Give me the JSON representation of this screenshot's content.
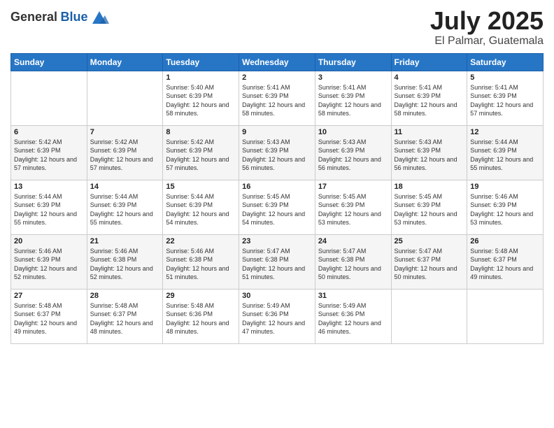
{
  "logo": {
    "general": "General",
    "blue": "Blue"
  },
  "title": "July 2025",
  "location": "El Palmar, Guatemala",
  "days_of_week": [
    "Sunday",
    "Monday",
    "Tuesday",
    "Wednesday",
    "Thursday",
    "Friday",
    "Saturday"
  ],
  "weeks": [
    [
      {
        "day": "",
        "sunrise": "",
        "sunset": "",
        "daylight": ""
      },
      {
        "day": "",
        "sunrise": "",
        "sunset": "",
        "daylight": ""
      },
      {
        "day": "1",
        "sunrise": "Sunrise: 5:40 AM",
        "sunset": "Sunset: 6:39 PM",
        "daylight": "Daylight: 12 hours and 58 minutes."
      },
      {
        "day": "2",
        "sunrise": "Sunrise: 5:41 AM",
        "sunset": "Sunset: 6:39 PM",
        "daylight": "Daylight: 12 hours and 58 minutes."
      },
      {
        "day": "3",
        "sunrise": "Sunrise: 5:41 AM",
        "sunset": "Sunset: 6:39 PM",
        "daylight": "Daylight: 12 hours and 58 minutes."
      },
      {
        "day": "4",
        "sunrise": "Sunrise: 5:41 AM",
        "sunset": "Sunset: 6:39 PM",
        "daylight": "Daylight: 12 hours and 58 minutes."
      },
      {
        "day": "5",
        "sunrise": "Sunrise: 5:41 AM",
        "sunset": "Sunset: 6:39 PM",
        "daylight": "Daylight: 12 hours and 57 minutes."
      }
    ],
    [
      {
        "day": "6",
        "sunrise": "Sunrise: 5:42 AM",
        "sunset": "Sunset: 6:39 PM",
        "daylight": "Daylight: 12 hours and 57 minutes."
      },
      {
        "day": "7",
        "sunrise": "Sunrise: 5:42 AM",
        "sunset": "Sunset: 6:39 PM",
        "daylight": "Daylight: 12 hours and 57 minutes."
      },
      {
        "day": "8",
        "sunrise": "Sunrise: 5:42 AM",
        "sunset": "Sunset: 6:39 PM",
        "daylight": "Daylight: 12 hours and 57 minutes."
      },
      {
        "day": "9",
        "sunrise": "Sunrise: 5:43 AM",
        "sunset": "Sunset: 6:39 PM",
        "daylight": "Daylight: 12 hours and 56 minutes."
      },
      {
        "day": "10",
        "sunrise": "Sunrise: 5:43 AM",
        "sunset": "Sunset: 6:39 PM",
        "daylight": "Daylight: 12 hours and 56 minutes."
      },
      {
        "day": "11",
        "sunrise": "Sunrise: 5:43 AM",
        "sunset": "Sunset: 6:39 PM",
        "daylight": "Daylight: 12 hours and 56 minutes."
      },
      {
        "day": "12",
        "sunrise": "Sunrise: 5:44 AM",
        "sunset": "Sunset: 6:39 PM",
        "daylight": "Daylight: 12 hours and 55 minutes."
      }
    ],
    [
      {
        "day": "13",
        "sunrise": "Sunrise: 5:44 AM",
        "sunset": "Sunset: 6:39 PM",
        "daylight": "Daylight: 12 hours and 55 minutes."
      },
      {
        "day": "14",
        "sunrise": "Sunrise: 5:44 AM",
        "sunset": "Sunset: 6:39 PM",
        "daylight": "Daylight: 12 hours and 55 minutes."
      },
      {
        "day": "15",
        "sunrise": "Sunrise: 5:44 AM",
        "sunset": "Sunset: 6:39 PM",
        "daylight": "Daylight: 12 hours and 54 minutes."
      },
      {
        "day": "16",
        "sunrise": "Sunrise: 5:45 AM",
        "sunset": "Sunset: 6:39 PM",
        "daylight": "Daylight: 12 hours and 54 minutes."
      },
      {
        "day": "17",
        "sunrise": "Sunrise: 5:45 AM",
        "sunset": "Sunset: 6:39 PM",
        "daylight": "Daylight: 12 hours and 53 minutes."
      },
      {
        "day": "18",
        "sunrise": "Sunrise: 5:45 AM",
        "sunset": "Sunset: 6:39 PM",
        "daylight": "Daylight: 12 hours and 53 minutes."
      },
      {
        "day": "19",
        "sunrise": "Sunrise: 5:46 AM",
        "sunset": "Sunset: 6:39 PM",
        "daylight": "Daylight: 12 hours and 53 minutes."
      }
    ],
    [
      {
        "day": "20",
        "sunrise": "Sunrise: 5:46 AM",
        "sunset": "Sunset: 6:39 PM",
        "daylight": "Daylight: 12 hours and 52 minutes."
      },
      {
        "day": "21",
        "sunrise": "Sunrise: 5:46 AM",
        "sunset": "Sunset: 6:38 PM",
        "daylight": "Daylight: 12 hours and 52 minutes."
      },
      {
        "day": "22",
        "sunrise": "Sunrise: 5:46 AM",
        "sunset": "Sunset: 6:38 PM",
        "daylight": "Daylight: 12 hours and 51 minutes."
      },
      {
        "day": "23",
        "sunrise": "Sunrise: 5:47 AM",
        "sunset": "Sunset: 6:38 PM",
        "daylight": "Daylight: 12 hours and 51 minutes."
      },
      {
        "day": "24",
        "sunrise": "Sunrise: 5:47 AM",
        "sunset": "Sunset: 6:38 PM",
        "daylight": "Daylight: 12 hours and 50 minutes."
      },
      {
        "day": "25",
        "sunrise": "Sunrise: 5:47 AM",
        "sunset": "Sunset: 6:37 PM",
        "daylight": "Daylight: 12 hours and 50 minutes."
      },
      {
        "day": "26",
        "sunrise": "Sunrise: 5:48 AM",
        "sunset": "Sunset: 6:37 PM",
        "daylight": "Daylight: 12 hours and 49 minutes."
      }
    ],
    [
      {
        "day": "27",
        "sunrise": "Sunrise: 5:48 AM",
        "sunset": "Sunset: 6:37 PM",
        "daylight": "Daylight: 12 hours and 49 minutes."
      },
      {
        "day": "28",
        "sunrise": "Sunrise: 5:48 AM",
        "sunset": "Sunset: 6:37 PM",
        "daylight": "Daylight: 12 hours and 48 minutes."
      },
      {
        "day": "29",
        "sunrise": "Sunrise: 5:48 AM",
        "sunset": "Sunset: 6:36 PM",
        "daylight": "Daylight: 12 hours and 48 minutes."
      },
      {
        "day": "30",
        "sunrise": "Sunrise: 5:49 AM",
        "sunset": "Sunset: 6:36 PM",
        "daylight": "Daylight: 12 hours and 47 minutes."
      },
      {
        "day": "31",
        "sunrise": "Sunrise: 5:49 AM",
        "sunset": "Sunset: 6:36 PM",
        "daylight": "Daylight: 12 hours and 46 minutes."
      },
      {
        "day": "",
        "sunrise": "",
        "sunset": "",
        "daylight": ""
      },
      {
        "day": "",
        "sunrise": "",
        "sunset": "",
        "daylight": ""
      }
    ]
  ]
}
